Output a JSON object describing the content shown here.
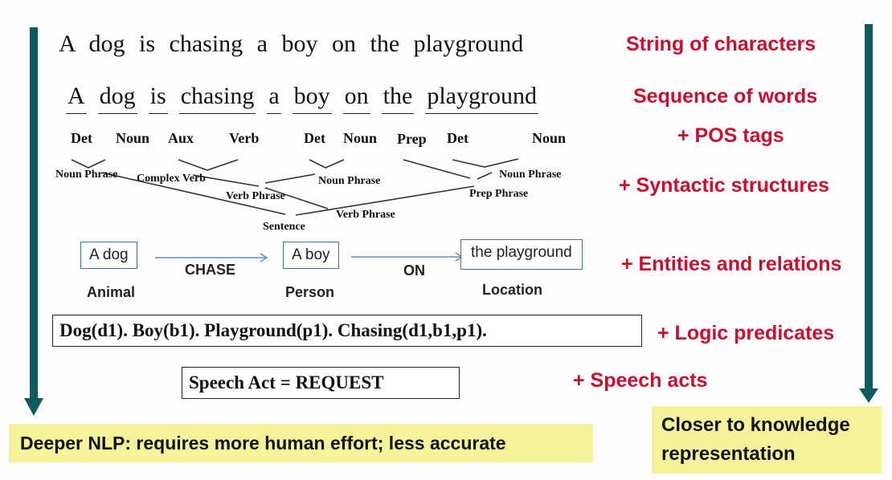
{
  "sentence": {
    "words": [
      "A",
      "dog",
      "is",
      "chasing",
      "a",
      "boy",
      "on",
      "the",
      "playground"
    ]
  },
  "pos_tags": [
    "Det",
    "Noun",
    "Aux",
    "Verb",
    "Det",
    "Noun",
    "Prep",
    "Det",
    "Noun"
  ],
  "phrases": {
    "np1": "Noun Phrase",
    "complex_verb": "Complex Verb",
    "np2": "Noun Phrase",
    "np3": "Noun Phrase",
    "vp1": "Verb Phrase",
    "prep_phrase": "Prep Phrase",
    "vp2": "Verb Phrase",
    "sentence": "Sentence"
  },
  "entities": [
    {
      "text": "A dog",
      "type": "Animal"
    },
    {
      "text": "A boy",
      "type": "Person"
    },
    {
      "text": "the playground",
      "type": "Location"
    }
  ],
  "relations": [
    "CHASE",
    "ON"
  ],
  "logic": "Dog(d1). Boy(b1). Playground(p1). Chasing(d1,b1,p1).",
  "speech_act": "Speech Act = REQUEST",
  "levels": [
    "String of characters",
    "Sequence of words",
    "+ POS tags",
    "+ Syntactic structures",
    "+ Entities and relations",
    "+ Logic predicates",
    "+ Speech acts"
  ],
  "left_note": "Deeper NLP: requires more human effort; less accurate",
  "right_note": "Closer to knowledge representation",
  "colors": {
    "arrow": "#0f5c5c",
    "accent": "#c8102e",
    "note_bg": "#f6f29a",
    "entity_border": "#3a6fa8"
  }
}
